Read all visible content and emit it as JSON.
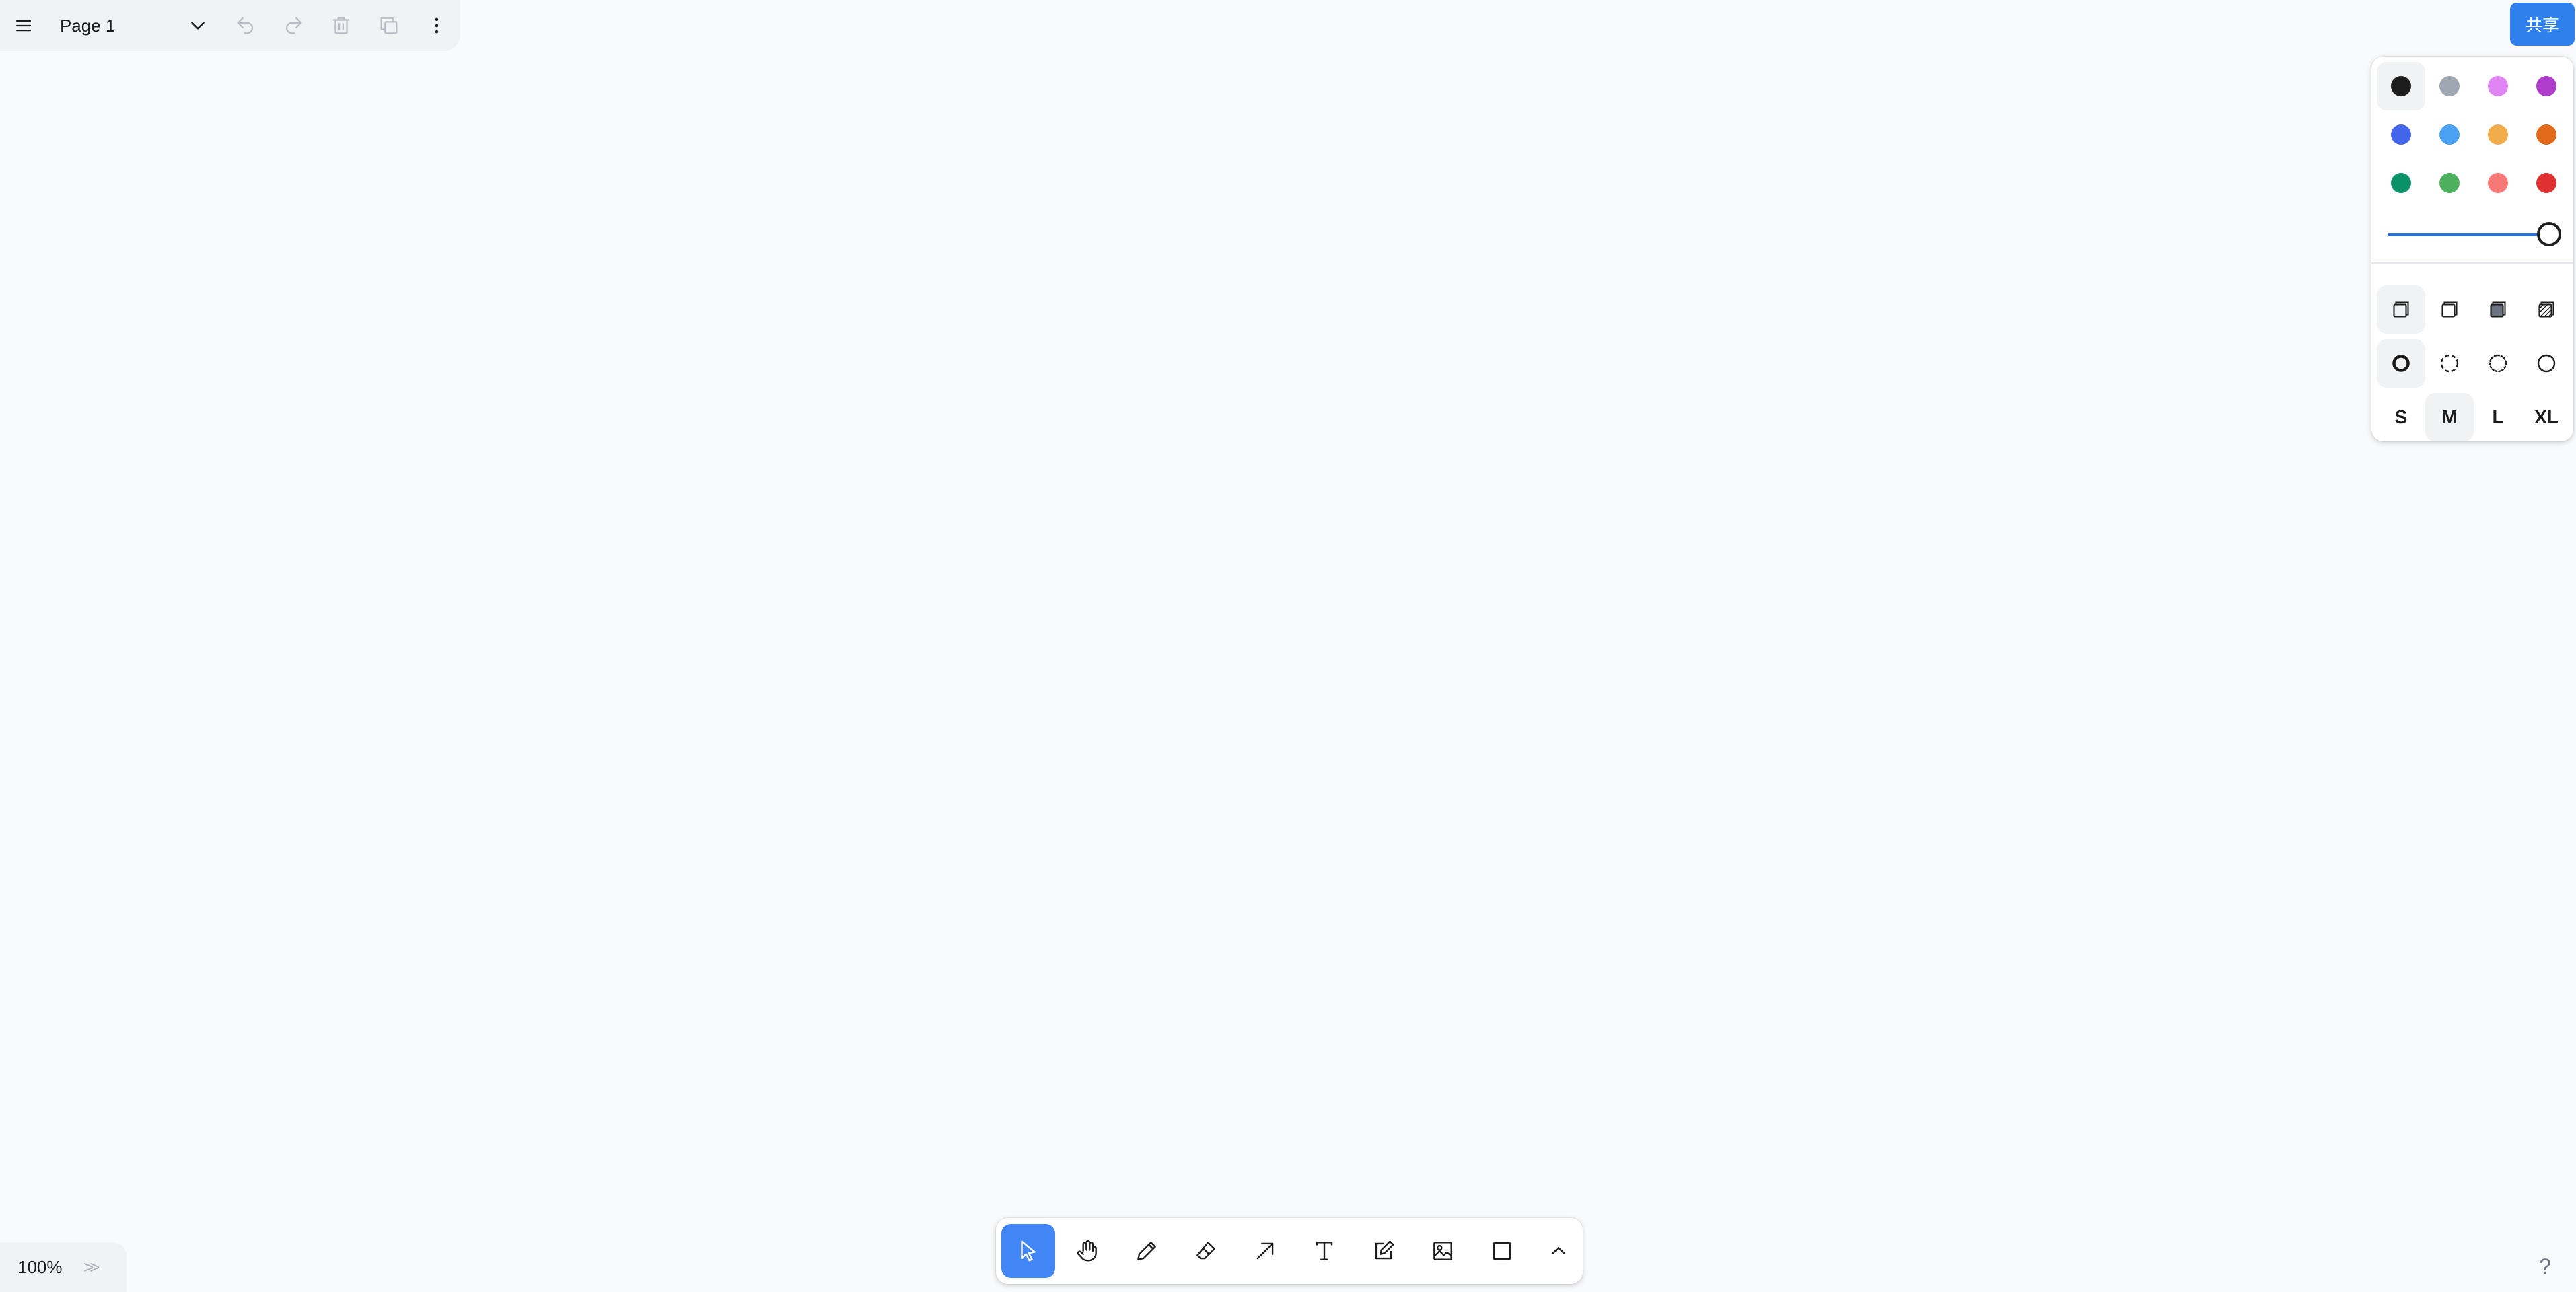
{
  "menu": {
    "page_name": "Page 1",
    "icons": [
      "menu-icon",
      "chevron-down-icon",
      "undo-icon",
      "redo-icon",
      "trash-icon",
      "duplicate-icon",
      "more-vertical-icon"
    ]
  },
  "share": {
    "label": "共享"
  },
  "style_panel": {
    "colors": [
      {
        "name": "black",
        "hex": "#1d1d1d",
        "selected": true
      },
      {
        "name": "grey",
        "hex": "#9fa8b2",
        "selected": false
      },
      {
        "name": "light-violet",
        "hex": "#e085f4",
        "selected": false
      },
      {
        "name": "violet",
        "hex": "#ae3ec9",
        "selected": false
      },
      {
        "name": "blue",
        "hex": "#4465e9",
        "selected": false
      },
      {
        "name": "light-blue",
        "hex": "#4ba1f1",
        "selected": false
      },
      {
        "name": "yellow",
        "hex": "#f1ac4b",
        "selected": false
      },
      {
        "name": "orange",
        "hex": "#e16919",
        "selected": false
      },
      {
        "name": "green",
        "hex": "#099268",
        "selected": false
      },
      {
        "name": "light-green",
        "hex": "#4cb05e",
        "selected": false
      },
      {
        "name": "light-red",
        "hex": "#f87777",
        "selected": false
      },
      {
        "name": "red",
        "hex": "#e03131",
        "selected": false
      }
    ],
    "opacity": 1.0,
    "fill_options": [
      "fill-none-icon",
      "fill-semi-icon",
      "fill-solid-icon",
      "fill-pattern-icon"
    ],
    "fill_selected": 0,
    "dash_options": [
      "dash-draw-icon",
      "dash-dashed-icon",
      "dash-dotted-icon",
      "dash-solid-icon"
    ],
    "dash_selected": 0,
    "sizes": [
      "S",
      "M",
      "L",
      "XL"
    ],
    "size_selected": 1
  },
  "toolbar": {
    "tools": [
      "select-icon",
      "hand-icon",
      "draw-icon",
      "eraser-icon",
      "arrow-icon",
      "text-icon",
      "note-icon",
      "image-icon",
      "rectangle-icon",
      "chevron-up-icon"
    ],
    "active": 0
  },
  "zoom": {
    "value": "100%",
    "expand": ">>"
  },
  "help": {
    "label": "?"
  }
}
